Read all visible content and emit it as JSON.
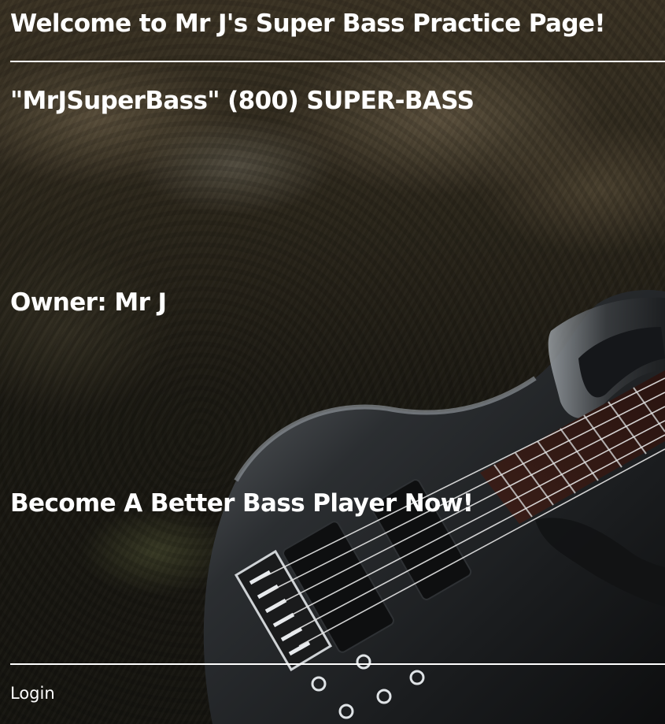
{
  "header": {
    "title": "Welcome to Mr J's Super Bass Practice Page!"
  },
  "main": {
    "phone_line": "\"MrJSuperBass\" (800) SUPER-BASS",
    "owner": "Owner: Mr J",
    "tagline": "Become A Better Bass Player Now!"
  },
  "footer": {
    "login_label": "Login"
  },
  "background": {
    "image": "bass-guitar-on-grunge-texture",
    "text_color": "#ffffff"
  }
}
